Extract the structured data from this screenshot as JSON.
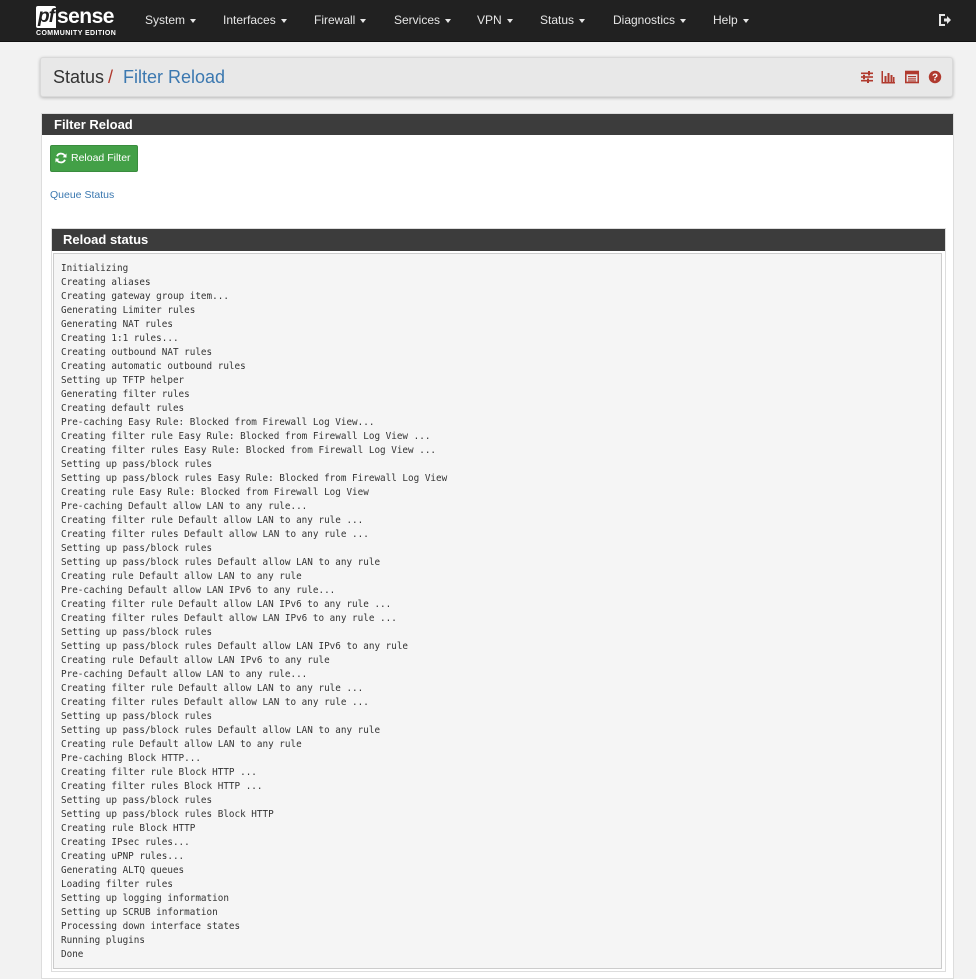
{
  "brand": {
    "name_pf": "pf",
    "name_sense": "sense",
    "edition": "COMMUNITY EDITION"
  },
  "nav": [
    "System",
    "Interfaces",
    "Firewall",
    "Services",
    "VPN",
    "Status",
    "Diagnostics",
    "Help"
  ],
  "header": {
    "section": "Status",
    "separator": "/",
    "page": "Filter Reload"
  },
  "header_icons": [
    "sliders-icon",
    "bar-chart-icon",
    "table-icon",
    "help-icon"
  ],
  "panel": {
    "title": "Filter Reload",
    "reload_button": "Reload Filter",
    "queue_link": "Queue Status"
  },
  "reload_status": {
    "title": "Reload status",
    "lines": [
      "Initializing",
      "Creating aliases",
      "Creating gateway group item...",
      "Generating Limiter rules",
      "Generating NAT rules",
      "Creating 1:1 rules...",
      "Creating outbound NAT rules",
      "Creating automatic outbound rules",
      "Setting up TFTP helper",
      "Generating filter rules",
      "Creating default rules",
      "Pre-caching Easy Rule: Blocked from Firewall Log View...",
      "Creating filter rule Easy Rule: Blocked from Firewall Log View ...",
      "Creating filter rules Easy Rule: Blocked from Firewall Log View ...",
      "Setting up pass/block rules",
      "Setting up pass/block rules Easy Rule: Blocked from Firewall Log View",
      "Creating rule Easy Rule: Blocked from Firewall Log View",
      "Pre-caching Default allow LAN to any rule...",
      "Creating filter rule Default allow LAN to any rule ...",
      "Creating filter rules Default allow LAN to any rule ...",
      "Setting up pass/block rules",
      "Setting up pass/block rules Default allow LAN to any rule",
      "Creating rule Default allow LAN to any rule",
      "Pre-caching Default allow LAN IPv6 to any rule...",
      "Creating filter rule Default allow LAN IPv6 to any rule ...",
      "Creating filter rules Default allow LAN IPv6 to any rule ...",
      "Setting up pass/block rules",
      "Setting up pass/block rules Default allow LAN IPv6 to any rule",
      "Creating rule Default allow LAN IPv6 to any rule",
      "Pre-caching Default allow LAN to any rule...",
      "Creating filter rule Default allow LAN to any rule ...",
      "Creating filter rules Default allow LAN to any rule ...",
      "Setting up pass/block rules",
      "Setting up pass/block rules Default allow LAN to any rule",
      "Creating rule Default allow LAN to any rule",
      "Pre-caching Block HTTP...",
      "Creating filter rule Block HTTP ...",
      "Creating filter rules Block HTTP ...",
      "Setting up pass/block rules",
      "Setting up pass/block rules Block HTTP",
      "Creating rule Block HTTP",
      "Creating IPsec rules...",
      "Creating uPNP rules...",
      "Generating ALTQ queues",
      "Loading filter rules",
      "Setting up logging information",
      "Setting up SCRUB information",
      "Processing down interface states",
      "Running plugins",
      "Done"
    ]
  },
  "colors": {
    "navbar": "#212121",
    "accent_red": "#b03a2e",
    "link_blue": "#3b78b0",
    "button_green": "#43a047",
    "panel_heading": "#3c3c3c"
  }
}
